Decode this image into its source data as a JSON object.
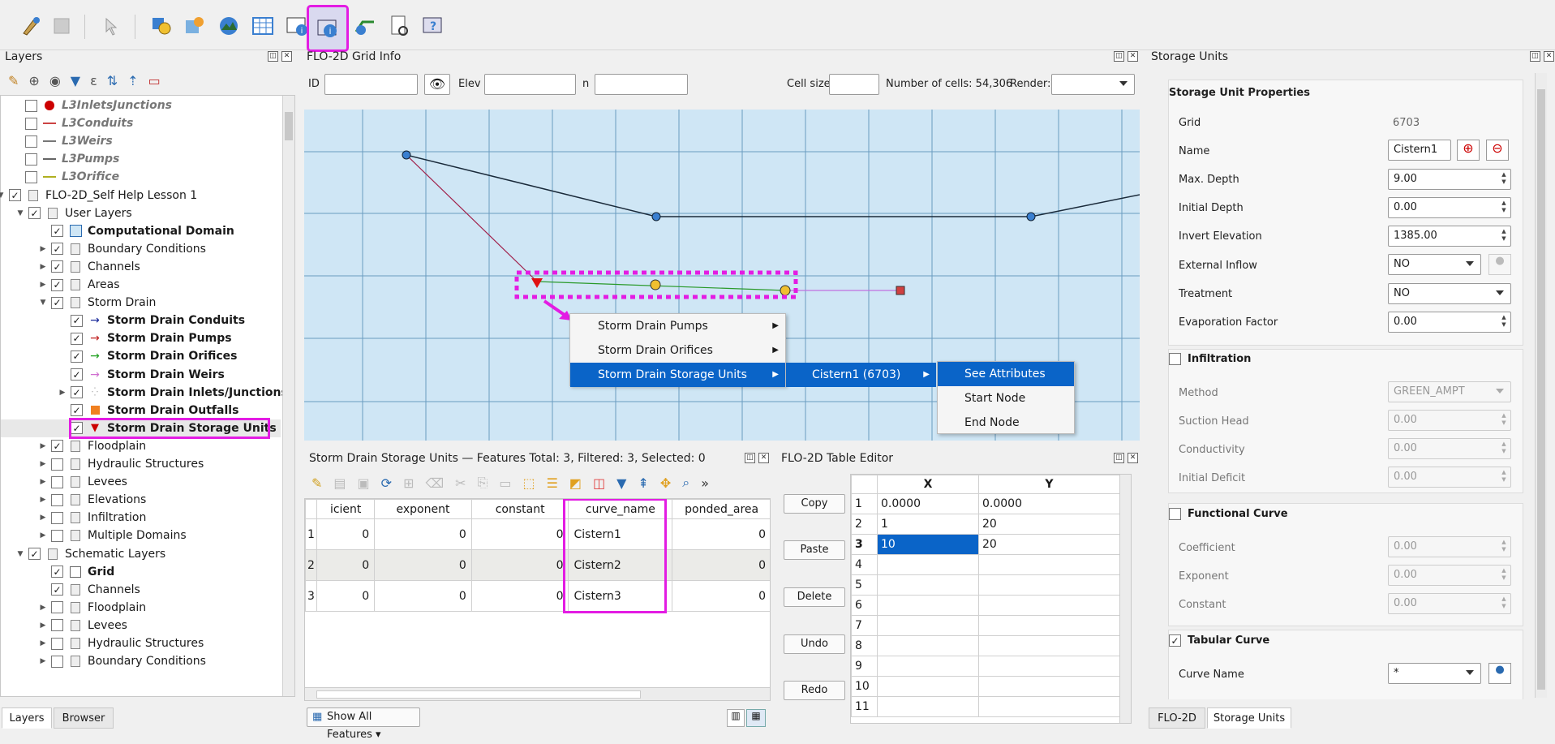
{
  "layers_panel": {
    "title": "Layers",
    "tree": [
      {
        "label": "L3InletsJunctions",
        "style": "muted",
        "checked": false
      },
      {
        "label": "L3Conduits",
        "style": "muted",
        "checked": false
      },
      {
        "label": "L3Weirs",
        "style": "muted",
        "checked": false
      },
      {
        "label": "L3Pumps",
        "style": "muted",
        "checked": false
      },
      {
        "label": "L3Orifice",
        "style": "muted",
        "checked": false
      },
      {
        "label": "FLO-2D_Self Help Lesson 1",
        "checked": true
      },
      {
        "label": "User Layers",
        "checked": true
      },
      {
        "label": "Computational Domain",
        "style": "bold",
        "checked": true
      },
      {
        "label": "Boundary Conditions",
        "checked": true
      },
      {
        "label": "Channels",
        "checked": true
      },
      {
        "label": "Areas",
        "checked": true
      },
      {
        "label": "Storm Drain",
        "checked": true
      },
      {
        "label": "Storm Drain Conduits",
        "style": "bold",
        "checked": true
      },
      {
        "label": "Storm Drain Pumps",
        "style": "bold",
        "checked": true
      },
      {
        "label": "Storm Drain Orifices",
        "style": "bold",
        "checked": true
      },
      {
        "label": "Storm Drain Weirs",
        "style": "bold",
        "checked": true
      },
      {
        "label": "Storm Drain Inlets/Junctions",
        "style": "bold",
        "checked": true
      },
      {
        "label": "Storm Drain Outfalls",
        "style": "bold",
        "checked": true
      },
      {
        "label": "Storm Drain Storage Units",
        "style": "bold",
        "checked": true
      },
      {
        "label": "Floodplain",
        "checked": true
      },
      {
        "label": "Hydraulic Structures",
        "checked": false
      },
      {
        "label": "Levees",
        "checked": false
      },
      {
        "label": "Elevations",
        "checked": false
      },
      {
        "label": "Infiltration",
        "checked": false
      },
      {
        "label": "Multiple Domains",
        "checked": false
      },
      {
        "label": "Schematic Layers",
        "checked": true
      },
      {
        "label": "Grid",
        "style": "bold",
        "checked": true
      },
      {
        "label": "Channels",
        "checked": true
      },
      {
        "label": "Floodplain",
        "checked": false
      },
      {
        "label": "Levees",
        "checked": false
      },
      {
        "label": "Hydraulic Structures",
        "checked": false
      },
      {
        "label": "Boundary Conditions",
        "checked": false
      }
    ],
    "tabs": [
      "Layers",
      "Browser"
    ]
  },
  "grid_info": {
    "title": "FLO-2D Grid Info",
    "id_label": "ID",
    "id_value": "",
    "elev_label": "Elev",
    "elev_value": "",
    "n_label": "n",
    "n_value": "",
    "cell_size_label": "Cell size",
    "cell_size_value": "",
    "num_cells": "Number of cells: 54,306",
    "render_label": "Render:",
    "render_value": ""
  },
  "context_menu": {
    "items": [
      "Storm Drain Pumps",
      "Storm Drain Orifices",
      "Storm Drain Storage Units"
    ],
    "submenu1": [
      "Cistern1 (6703)"
    ],
    "submenu2": [
      "See Attributes",
      "Start Node",
      "End Node"
    ]
  },
  "attribute_table": {
    "title": "Storm Drain Storage Units — Features Total: 3, Filtered: 3, Selected: 0",
    "columns": [
      "icient",
      "exponent",
      "constant",
      "curve_name",
      "ponded_area"
    ],
    "rows": [
      {
        "n": "1",
        "cells": [
          "0",
          "0",
          "0",
          "Cistern1",
          "0"
        ]
      },
      {
        "n": "2",
        "cells": [
          "0",
          "0",
          "0",
          "Cistern2",
          "0"
        ]
      },
      {
        "n": "3",
        "cells": [
          "0",
          "0",
          "0",
          "Cistern3",
          "0"
        ]
      }
    ],
    "show_all": "Show All Features"
  },
  "table_editor": {
    "title": "FLO-2D Table Editor",
    "buttons": [
      "Copy",
      "Paste",
      "Delete",
      "Undo",
      "Redo"
    ],
    "col_x": "X",
    "col_y": "Y",
    "rows": [
      {
        "n": "1",
        "x": "0.0000",
        "y": "0.0000"
      },
      {
        "n": "2",
        "x": "1",
        "y": "20"
      },
      {
        "n": "3",
        "x": "10",
        "y": "20"
      },
      {
        "n": "4",
        "x": "",
        "y": ""
      },
      {
        "n": "5",
        "x": "",
        "y": ""
      },
      {
        "n": "6",
        "x": "",
        "y": ""
      },
      {
        "n": "7",
        "x": "",
        "y": ""
      },
      {
        "n": "8",
        "x": "",
        "y": ""
      },
      {
        "n": "9",
        "x": "",
        "y": ""
      },
      {
        "n": "10",
        "x": "",
        "y": ""
      },
      {
        "n": "11",
        "x": "",
        "y": ""
      }
    ]
  },
  "storage_units": {
    "title": "Storage Units",
    "section_title": "Storage Unit Properties",
    "grid_label": "Grid",
    "grid_value": "6703",
    "name_label": "Name",
    "name_value": "Cistern1",
    "max_depth_label": "Max. Depth",
    "max_depth_value": "9.00",
    "initial_depth_label": "Initial Depth",
    "initial_depth_value": "0.00",
    "invert_elev_label": "Invert Elevation",
    "invert_elev_value": "1385.00",
    "external_inflow_label": "External Inflow",
    "external_inflow_value": "NO",
    "treatment_label": "Treatment",
    "treatment_value": "NO",
    "evap_label": "Evaporation Factor",
    "evap_value": "0.00",
    "infiltration_title": "Infiltration",
    "method_label": "Method",
    "method_value": "GREEN_AMPT",
    "suction_label": "Suction Head",
    "suction_value": "0.00",
    "conductivity_label": "Conductivity",
    "conductivity_value": "0.00",
    "initial_deficit_label": "Initial Deficit",
    "initial_deficit_value": "0.00",
    "functional_title": "Functional Curve",
    "coefficient_label": "Coefficient",
    "coefficient_value": "0.00",
    "exponent_label": "Exponent",
    "exponent_value": "0.00",
    "constant_label": "Constant",
    "constant_value": "0.00",
    "tabular_title": "Tabular Curve",
    "curve_name_label": "Curve Name",
    "curve_name_value": "*",
    "bottom_tabs": [
      "FLO-2D",
      "Storage Units"
    ]
  },
  "colors": {
    "highlight": "#e31ce3",
    "selection": "#0a64c8",
    "map_bg": "#cfe6f5"
  }
}
